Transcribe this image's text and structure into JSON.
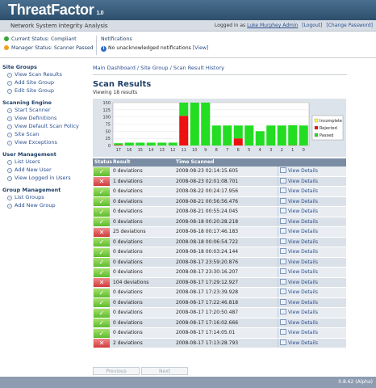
{
  "header": {
    "logo_a": "Threat",
    "logo_b": "Factor",
    "version": "1.0",
    "app_name": "Network System Integrity Analysis",
    "logged_in_prefix": "Logged in as",
    "user": "Luke Murphey Admin",
    "logout": "[Logout]",
    "change_password": "[Change Password]"
  },
  "status": {
    "current": "Current Status: Compliant",
    "manager": "Manager Status: Scanner Passed",
    "notifications_title": "Notifications",
    "notifications_text": "No unacknowledged notifications",
    "notifications_link": "[View]"
  },
  "sidebar": {
    "groups": [
      {
        "title": "Site Groups",
        "items": [
          "View Scan Results",
          "Add Site Group",
          "Edit Site Group"
        ]
      },
      {
        "title": "Scanning Engine",
        "items": [
          "Start Scanner",
          "View Definitions",
          "View Default Scan Policy",
          "Site Scan",
          "View Exceptions"
        ]
      },
      {
        "title": "User Management",
        "items": [
          "List Users",
          "Add New User",
          "View Logged in Users"
        ]
      },
      {
        "title": "Group Management",
        "items": [
          "List Groups",
          "Add New Group"
        ]
      }
    ]
  },
  "main": {
    "breadcrumb": "Main Dashboard / Site Group / Scan Result History",
    "title": "Scan Results",
    "subtitle": "Viewing 18 results"
  },
  "chart_data": {
    "type": "bar",
    "categories": [
      "17",
      "16",
      "15",
      "14",
      "13",
      "12",
      "11",
      "10",
      "9",
      "8",
      "7",
      "6",
      "5",
      "4",
      "3",
      "2",
      "1",
      "0"
    ],
    "series": [
      {
        "name": "Incomplete",
        "color": "#ffff33",
        "values": [
          0,
          0,
          0,
          0,
          0,
          0,
          0,
          0,
          0,
          0,
          0,
          0,
          0,
          0,
          0,
          0,
          0,
          0
        ]
      },
      {
        "name": "Rejected",
        "color": "#ee1111",
        "values": [
          2,
          0,
          0,
          0,
          0,
          0,
          104,
          0,
          0,
          0,
          0,
          25,
          0,
          0,
          0,
          0,
          1,
          0
        ]
      },
      {
        "name": "Passed",
        "color": "#22dd22",
        "values": [
          6,
          10,
          10,
          10,
          10,
          10,
          46,
          150,
          150,
          70,
          70,
          45,
          70,
          50,
          70,
          70,
          70,
          70
        ]
      }
    ],
    "stacked": true,
    "ylim": [
      0,
      150
    ],
    "yticks": [
      0,
      25,
      50,
      75,
      100,
      125,
      150
    ],
    "legend": "right"
  },
  "table": {
    "headers": [
      "Status",
      "Result",
      "Time Scanned",
      ""
    ],
    "link_label": "View Details",
    "rows": [
      {
        "status": "ok",
        "result": "0 deviations",
        "time": "2008-08-23 02:14:15.605"
      },
      {
        "status": "bad",
        "result": "1 deviations",
        "time": "2008-08-23 02:01:08.701"
      },
      {
        "status": "ok",
        "result": "0 deviations",
        "time": "2008-08-22 00:24:17.956"
      },
      {
        "status": "ok",
        "result": "0 deviations",
        "time": "2008-08-21 00:56:56.476"
      },
      {
        "status": "ok",
        "result": "0 deviations",
        "time": "2008-08-21 00:55:24.045"
      },
      {
        "status": "ok",
        "result": "0 deviations",
        "time": "2008-08-18 00:20:28.218"
      },
      {
        "status": "bad",
        "result": "25 deviations",
        "time": "2008-08-18 00:17:46.183"
      },
      {
        "status": "ok",
        "result": "0 deviations",
        "time": "2008-08-18 00:06:54.722"
      },
      {
        "status": "ok",
        "result": "0 deviations",
        "time": "2008-08-18 00:03:24.144"
      },
      {
        "status": "ok",
        "result": "0 deviations",
        "time": "2008-08-17 23:59:20.876"
      },
      {
        "status": "ok",
        "result": "0 deviations",
        "time": "2008-08-17 23:30:16.207"
      },
      {
        "status": "bad",
        "result": "104 deviations",
        "time": "2008-08-17 17:29:12.927"
      },
      {
        "status": "ok",
        "result": "0 deviations",
        "time": "2008-08-17 17:23:39.928"
      },
      {
        "status": "ok",
        "result": "0 deviations",
        "time": "2008-08-17 17:22:46.818"
      },
      {
        "status": "ok",
        "result": "0 deviations",
        "time": "2008-08-17 17:20:50.487"
      },
      {
        "status": "ok",
        "result": "0 deviations",
        "time": "2008-08-17 17:16:02.666"
      },
      {
        "status": "ok",
        "result": "0 deviations",
        "time": "2008-08-17 17:14:05.01"
      },
      {
        "status": "bad",
        "result": "2 deviations",
        "time": "2008-08-17 17:13:28.793"
      }
    ]
  },
  "pager": {
    "previous": "Previous",
    "next": "Next"
  },
  "footer": {
    "version": "0.8.62 (Alpha)"
  }
}
